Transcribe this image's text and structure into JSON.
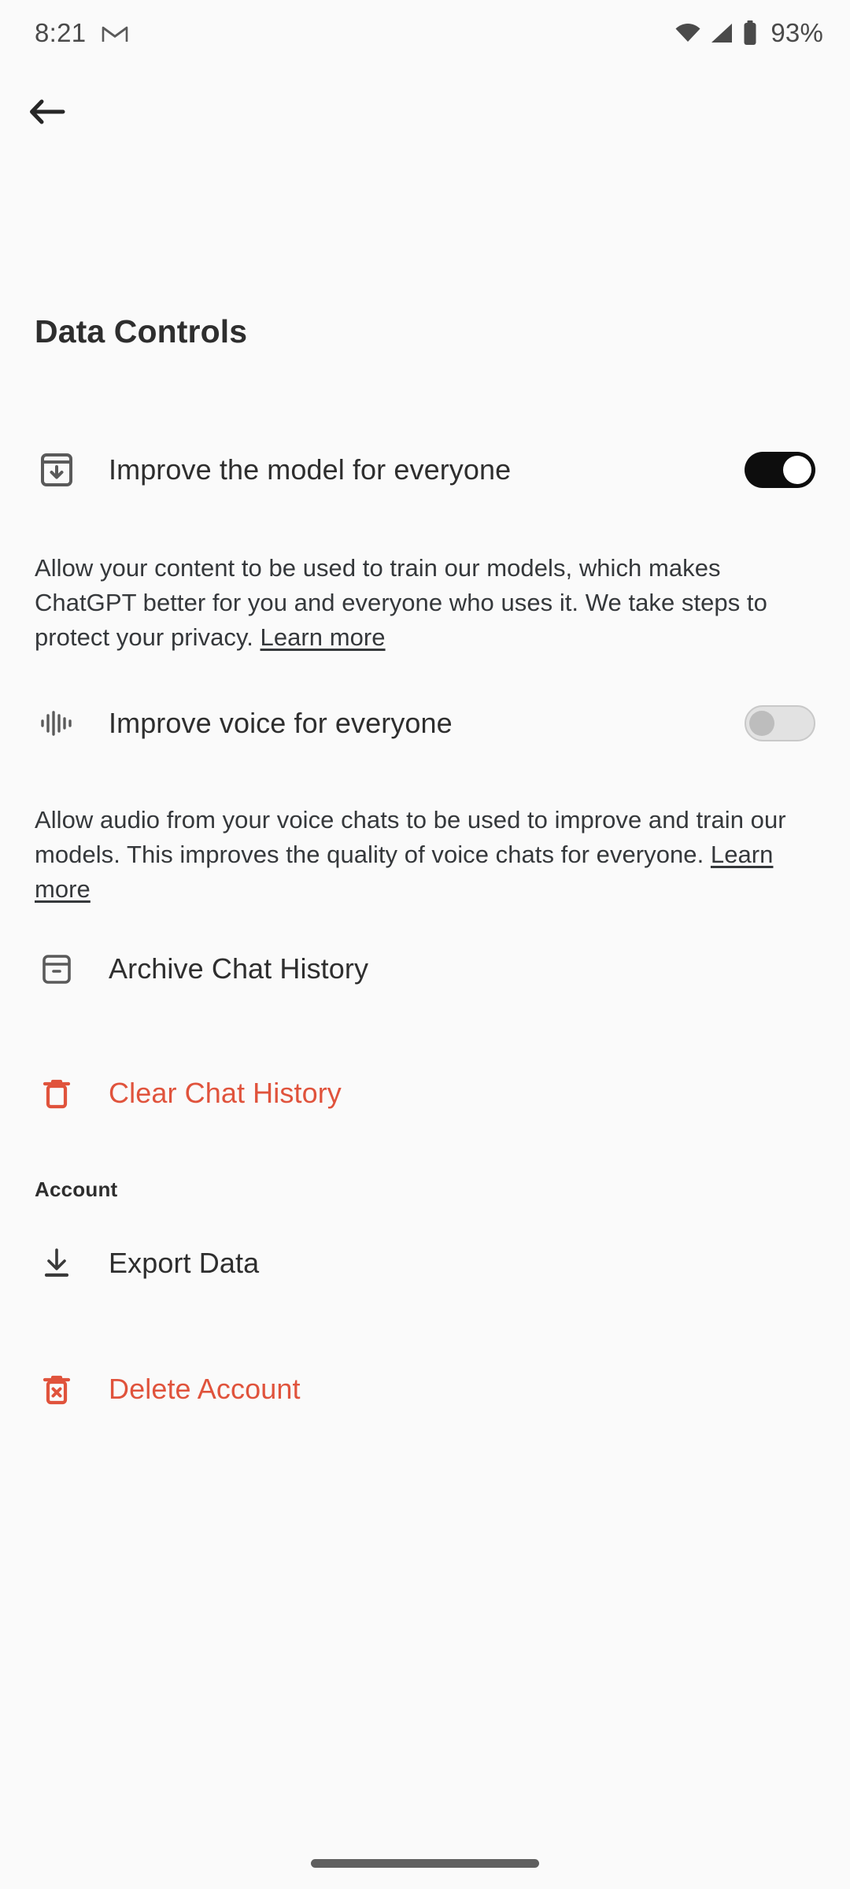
{
  "status_bar": {
    "time": "8:21",
    "notification_icon": "gmail-icon",
    "wifi_icon": "wifi-icon",
    "signal_icon": "cellular-signal-icon",
    "battery_icon": "battery-icon",
    "battery_percent": "93%"
  },
  "nav": {
    "back_icon": "back-arrow-icon"
  },
  "header": {
    "title": "Data Controls"
  },
  "settings": {
    "improve_model": {
      "icon": "archive-download-icon",
      "label": "Improve the model for everyone",
      "toggle_state": "on",
      "description": "Allow your content to be used to train our models, which makes ChatGPT better for you and everyone who uses it. We take steps to protect your privacy. ",
      "link_label": "Learn more"
    },
    "improve_voice": {
      "icon": "voice-waveform-icon",
      "label": "Improve voice for everyone",
      "toggle_state": "off",
      "description": "Allow audio from your voice chats to be used to improve and train our models. This improves the quality of voice chats for everyone. ",
      "link_label": "Learn more"
    },
    "archive_chat_history": {
      "icon": "archive-box-icon",
      "label": "Archive Chat History"
    },
    "clear_chat_history": {
      "icon": "trash-icon",
      "label": "Clear Chat History"
    }
  },
  "account_section": {
    "header": "Account",
    "export_data": {
      "icon": "download-icon",
      "label": "Export Data"
    },
    "delete_account": {
      "icon": "trash-x-icon",
      "label": "Delete Account"
    }
  },
  "system": {
    "home_indicator": "home-indicator"
  },
  "colors": {
    "background": "#fafafa",
    "text_primary": "#2e2e2e",
    "text_secondary": "#35383b",
    "danger": "#e0533c",
    "toggle_on": "#0d0d0d",
    "toggle_off_track": "#e2e2e2",
    "icon_gray": "#5a5a5a"
  }
}
